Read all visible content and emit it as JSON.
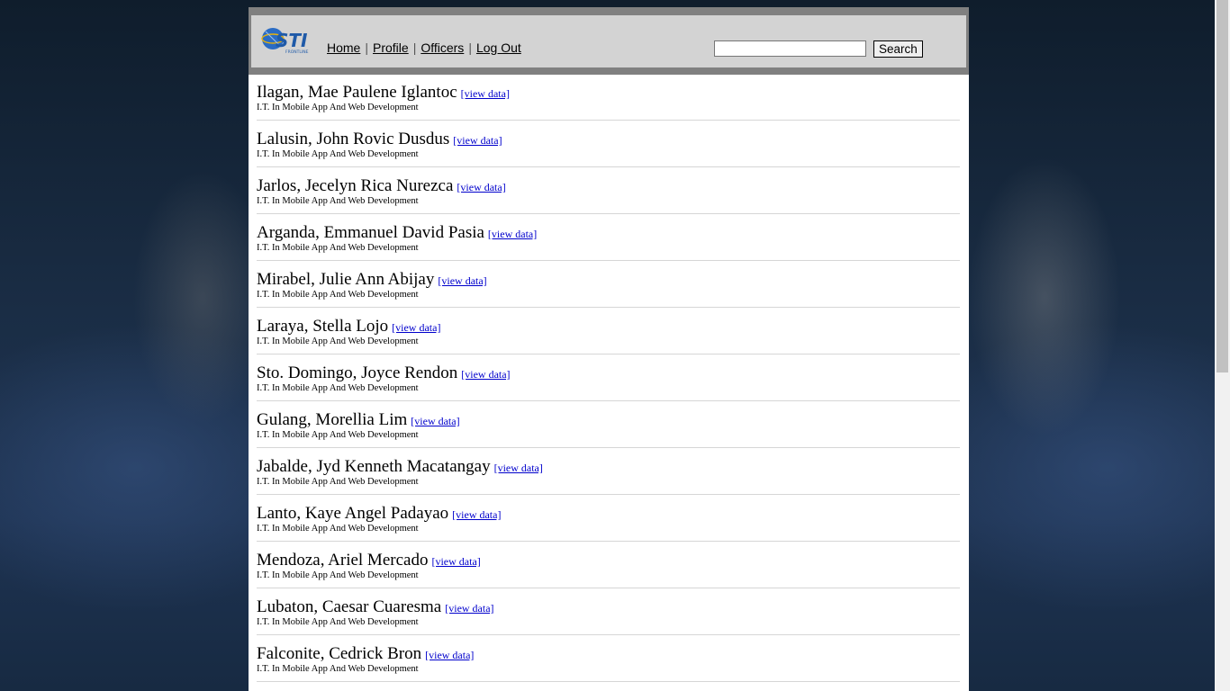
{
  "logo": {
    "text": "STI",
    "subtext": "FRONTLINE",
    "colors": {
      "globe": "#1f5aa8",
      "accent": "#e8b20c"
    }
  },
  "nav": [
    {
      "label": "Home"
    },
    {
      "label": "Profile"
    },
    {
      "label": "Officers"
    },
    {
      "label": "Log Out"
    }
  ],
  "search": {
    "value": "",
    "placeholder": "",
    "button_label": "Search"
  },
  "view_link_label": "[view data]",
  "students": [
    {
      "name": "Ilagan, Mae Paulene Iglantoc",
      "course": "I.T. In Mobile App And Web Development"
    },
    {
      "name": "Lalusin, John Rovic Dusdus",
      "course": "I.T. In Mobile App And Web Development"
    },
    {
      "name": "Jarlos, Jecelyn Rica Nurezca",
      "course": "I.T. In Mobile App And Web Development"
    },
    {
      "name": "Arganda, Emmanuel David Pasia",
      "course": "I.T. In Mobile App And Web Development"
    },
    {
      "name": "Mirabel, Julie Ann Abijay",
      "course": "I.T. In Mobile App And Web Development"
    },
    {
      "name": "Laraya, Stella Lojo",
      "course": "I.T. In Mobile App And Web Development"
    },
    {
      "name": "Sto. Domingo, Joyce Rendon",
      "course": "I.T. In Mobile App And Web Development"
    },
    {
      "name": "Gulang, Morellia Lim",
      "course": "I.T. In Mobile App And Web Development"
    },
    {
      "name": "Jabalde, Jyd Kenneth Macatangay",
      "course": "I.T. In Mobile App And Web Development"
    },
    {
      "name": "Lanto, Kaye Angel Padayao",
      "course": "I.T. In Mobile App And Web Development"
    },
    {
      "name": "Mendoza, Ariel Mercado",
      "course": "I.T. In Mobile App And Web Development"
    },
    {
      "name": "Lubaton, Caesar Cuaresma",
      "course": "I.T. In Mobile App And Web Development"
    },
    {
      "name": "Falconite, Cedrick Bron",
      "course": "I.T. In Mobile App And Web Development"
    }
  ]
}
